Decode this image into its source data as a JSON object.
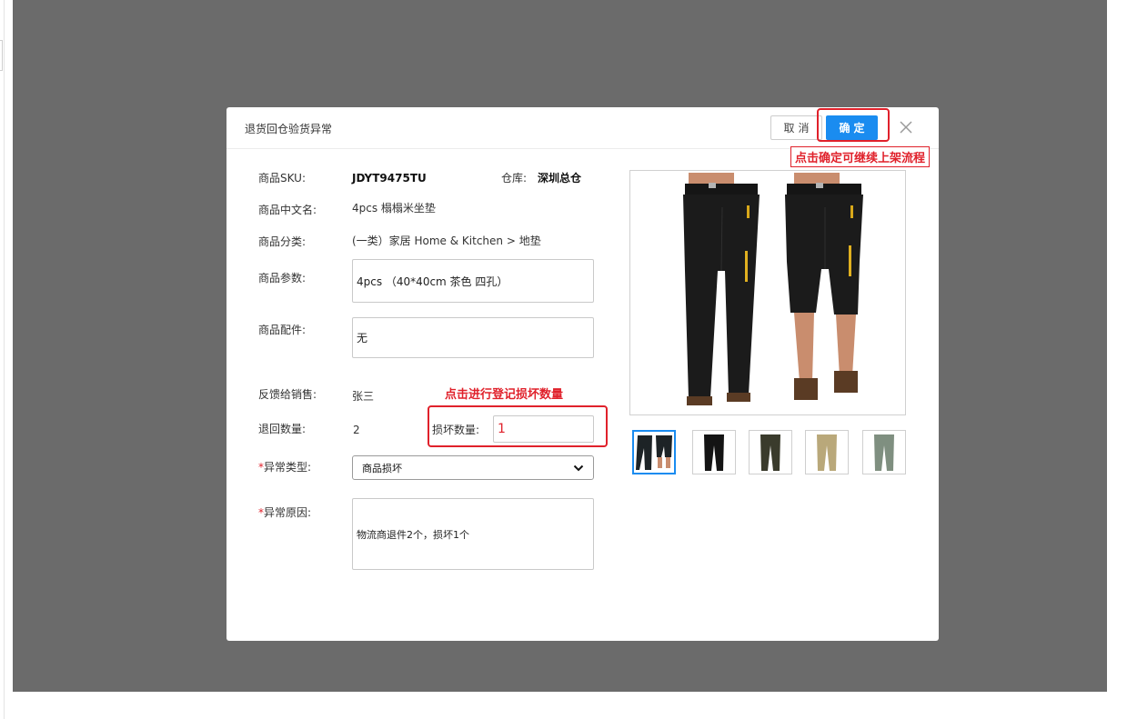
{
  "modal": {
    "title": "退货回仓验货异常",
    "cancel_label": "取消",
    "confirm_label": "确定",
    "confirm_annotation": "点击确定可继续上架流程"
  },
  "form": {
    "sku": {
      "label": "商品SKU:",
      "value": "JDYT9475TU"
    },
    "warehouse": {
      "label": "仓库:",
      "value": "深圳总仓"
    },
    "cn_name": {
      "label": "商品中文名:",
      "value": "4pcs 榻榻米坐垫"
    },
    "category": {
      "label": "商品分类:",
      "value": "(一类）家居 Home & Kitchen  >  地垫"
    },
    "params": {
      "label": "商品参数:",
      "value": "4pcs （40*40cm 茶色 四孔）"
    },
    "accessories": {
      "label": "商品配件:",
      "value": "无"
    },
    "feedback": {
      "label": "反馈给销售:",
      "value": "张三"
    },
    "return_qty": {
      "label": "退回数量:",
      "value": "2"
    },
    "damage_qty": {
      "label": "损坏数量:",
      "value": "1",
      "annotation": "点击进行登记损坏数量"
    },
    "abnormal_type": {
      "required_mark": "*",
      "label": "异常类型:",
      "value": "商品损坏"
    },
    "abnormal_reason": {
      "required_mark": "*",
      "label": "异常原因:",
      "value": "物流商退件2个，损坏1个"
    }
  },
  "gallery": {
    "colors": [
      "#1d2326",
      "#141414",
      "#3a3b2c",
      "#b9a87a",
      "#7f8f80"
    ],
    "selected_index": 0
  },
  "colors": {
    "accent": "#1a8cf0",
    "annotation_red": "#e0212b",
    "overlay": "#6b6b6b"
  }
}
